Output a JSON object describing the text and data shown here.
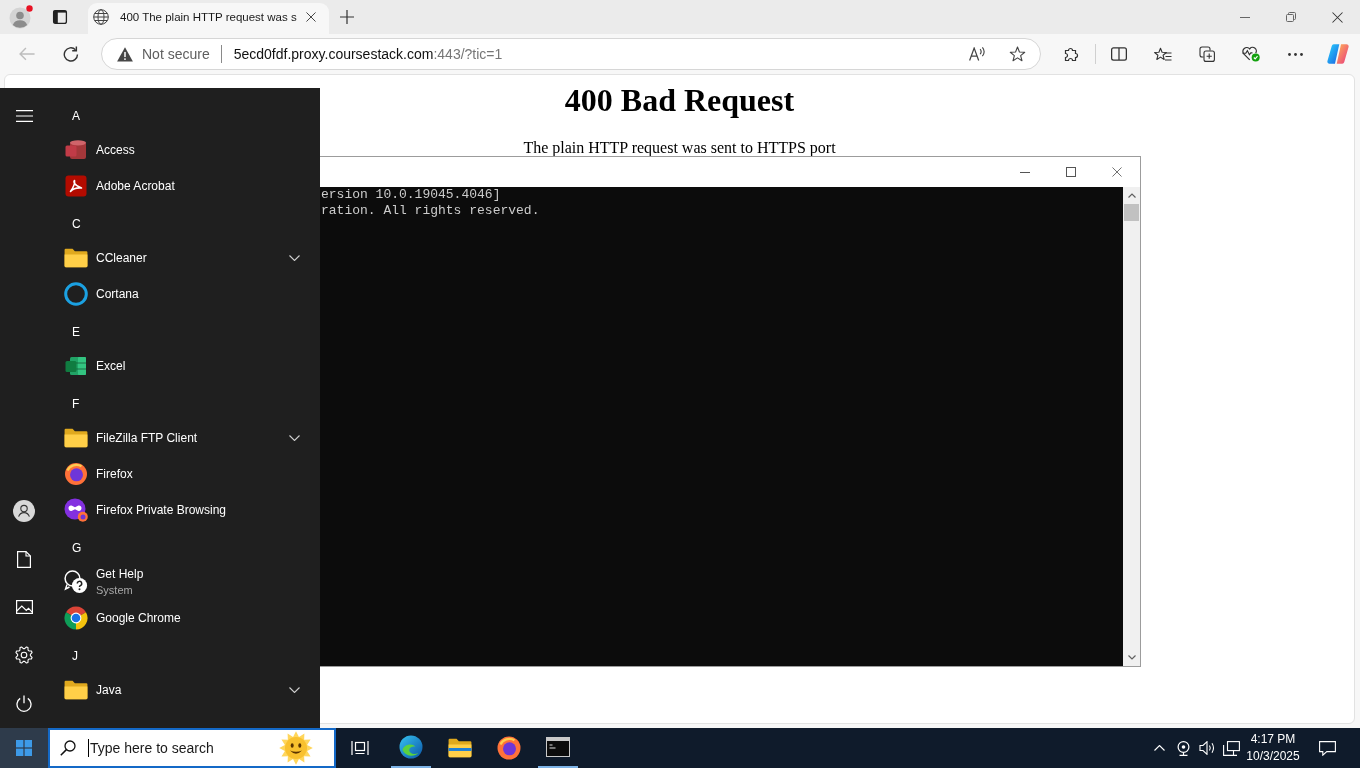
{
  "browser": {
    "tabs": [
      {
        "title": "400 The plain HTTP request was s",
        "selected": true
      }
    ],
    "toolbar": {
      "back": {
        "disabled": true
      }
    },
    "address_bar": {
      "security": "Not secure",
      "host": "5ecd0fdf.proxy.coursestack.com",
      "rest": ":443/?tic=1"
    }
  },
  "page": {
    "heading": "400 Bad Request",
    "message": "The plain HTTP request was sent to HTTPS port"
  },
  "console_window": {
    "lines": [
      "ersion 10.0.19045.4046]",
      "ration. All rights reserved."
    ]
  },
  "start_menu": {
    "groups": [
      {
        "letter": "A",
        "apps": [
          {
            "name": "Access",
            "kind": "app"
          },
          {
            "name": "Adobe Acrobat",
            "kind": "app"
          }
        ]
      },
      {
        "letter": "C",
        "apps": [
          {
            "name": "CCleaner",
            "kind": "folder",
            "expanded": false
          },
          {
            "name": "Cortana",
            "kind": "app"
          }
        ]
      },
      {
        "letter": "E",
        "apps": [
          {
            "name": "Excel",
            "kind": "app"
          }
        ]
      },
      {
        "letter": "F",
        "apps": [
          {
            "name": "FileZilla FTP Client",
            "kind": "folder",
            "expanded": false
          },
          {
            "name": "Firefox",
            "kind": "app"
          },
          {
            "name": "Firefox Private Browsing",
            "kind": "app"
          }
        ]
      },
      {
        "letter": "G",
        "apps": [
          {
            "name": "Get Help",
            "subtitle": "System",
            "kind": "app"
          },
          {
            "name": "Google Chrome",
            "kind": "app"
          }
        ]
      },
      {
        "letter": "J",
        "apps": [
          {
            "name": "Java",
            "kind": "folder",
            "expanded": false
          }
        ]
      }
    ]
  },
  "taskbar": {
    "start_button": {
      "active": true
    },
    "search": {
      "placeholder": "Type here to search"
    },
    "apps": [
      {
        "running": true
      },
      {
        "running": false
      },
      {
        "running": false
      },
      {
        "running": true
      }
    ],
    "clock": {
      "time": "4:17 PM",
      "date": "10/3/2025"
    }
  }
}
